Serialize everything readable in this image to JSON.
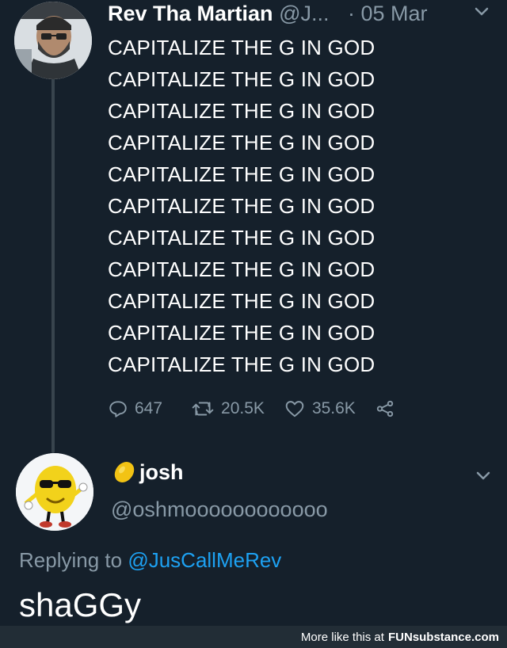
{
  "tweet": {
    "author_name": "Rev Tha Martian",
    "author_handle": "@J...",
    "date": "· 05 Mar",
    "lines": [
      "CAPITALIZE THE G IN GOD",
      "CAPITALIZE THE G IN GOD",
      "CAPITALIZE THE G IN GOD",
      "CAPITALIZE THE G IN GOD",
      "CAPITALIZE THE G IN GOD",
      "CAPITALIZE THE G IN GOD",
      "CAPITALIZE THE G IN GOD",
      "CAPITALIZE THE G IN GOD",
      "CAPITALIZE THE G IN GOD",
      "CAPITALIZE THE G IN GOD",
      "CAPITALIZE THE G IN GOD"
    ],
    "replies": "647",
    "retweets": "20.5K",
    "likes": "35.6K"
  },
  "reply": {
    "author_name": "josh",
    "author_handle": "@oshmoooooooooooo",
    "replying_prefix": "Replying to",
    "replying_to": "@JusCallMeRev",
    "text": "shaGGy"
  },
  "footer": {
    "prefix": "More like this at",
    "brand_fun": "FUN",
    "brand_rest": "substance.com"
  },
  "icons": {
    "reply": "reply-icon",
    "retweet": "retweet-icon",
    "like": "heart-icon",
    "share": "share-icon",
    "menu": "chevron-down-icon",
    "emoji": "lemon-icon"
  },
  "colors": {
    "background": "#15202b",
    "secondary_text": "#8899a6",
    "link": "#1da1f2"
  }
}
